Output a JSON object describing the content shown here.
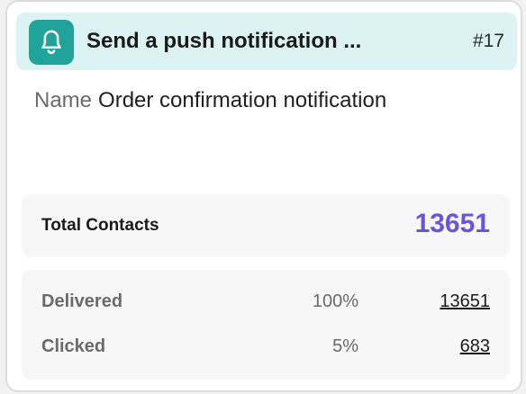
{
  "header": {
    "icon": "bell-icon",
    "title": "Send a push notification ...",
    "id": "#17",
    "accent_color": "#1fa39a",
    "background_color": "#dbf3f3"
  },
  "name": {
    "label": "Name",
    "value": "Order confirmation notification"
  },
  "total": {
    "label": "Total Contacts",
    "value": "13651",
    "color": "#6a55d6"
  },
  "stats": [
    {
      "label": "Delivered",
      "percent": "100%",
      "count": "13651"
    },
    {
      "label": "Clicked",
      "percent": "5%",
      "count": "683"
    }
  ]
}
